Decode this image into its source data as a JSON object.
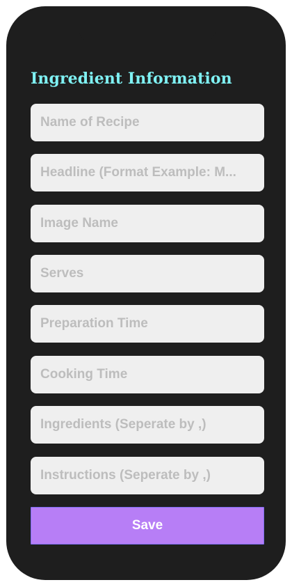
{
  "form": {
    "title": "Ingredient Information",
    "fields": [
      {
        "placeholder": "Name of Recipe",
        "value": ""
      },
      {
        "placeholder": "Headline (Format Example: M...",
        "value": ""
      },
      {
        "placeholder": "Image Name",
        "value": ""
      },
      {
        "placeholder": "Serves",
        "value": ""
      },
      {
        "placeholder": "Preparation Time",
        "value": ""
      },
      {
        "placeholder": "Cooking Time",
        "value": ""
      },
      {
        "placeholder": "Ingredients (Seperate by ,)",
        "value": ""
      },
      {
        "placeholder": "Instructions (Seperate by ,)",
        "value": ""
      }
    ],
    "save_label": "Save"
  },
  "colors": {
    "title": "#7ff1f3",
    "field_background": "#efefef",
    "placeholder_text": "#bdbdbd",
    "save_button": "#b77ef6",
    "phone_frame": "#1e1e1e"
  }
}
